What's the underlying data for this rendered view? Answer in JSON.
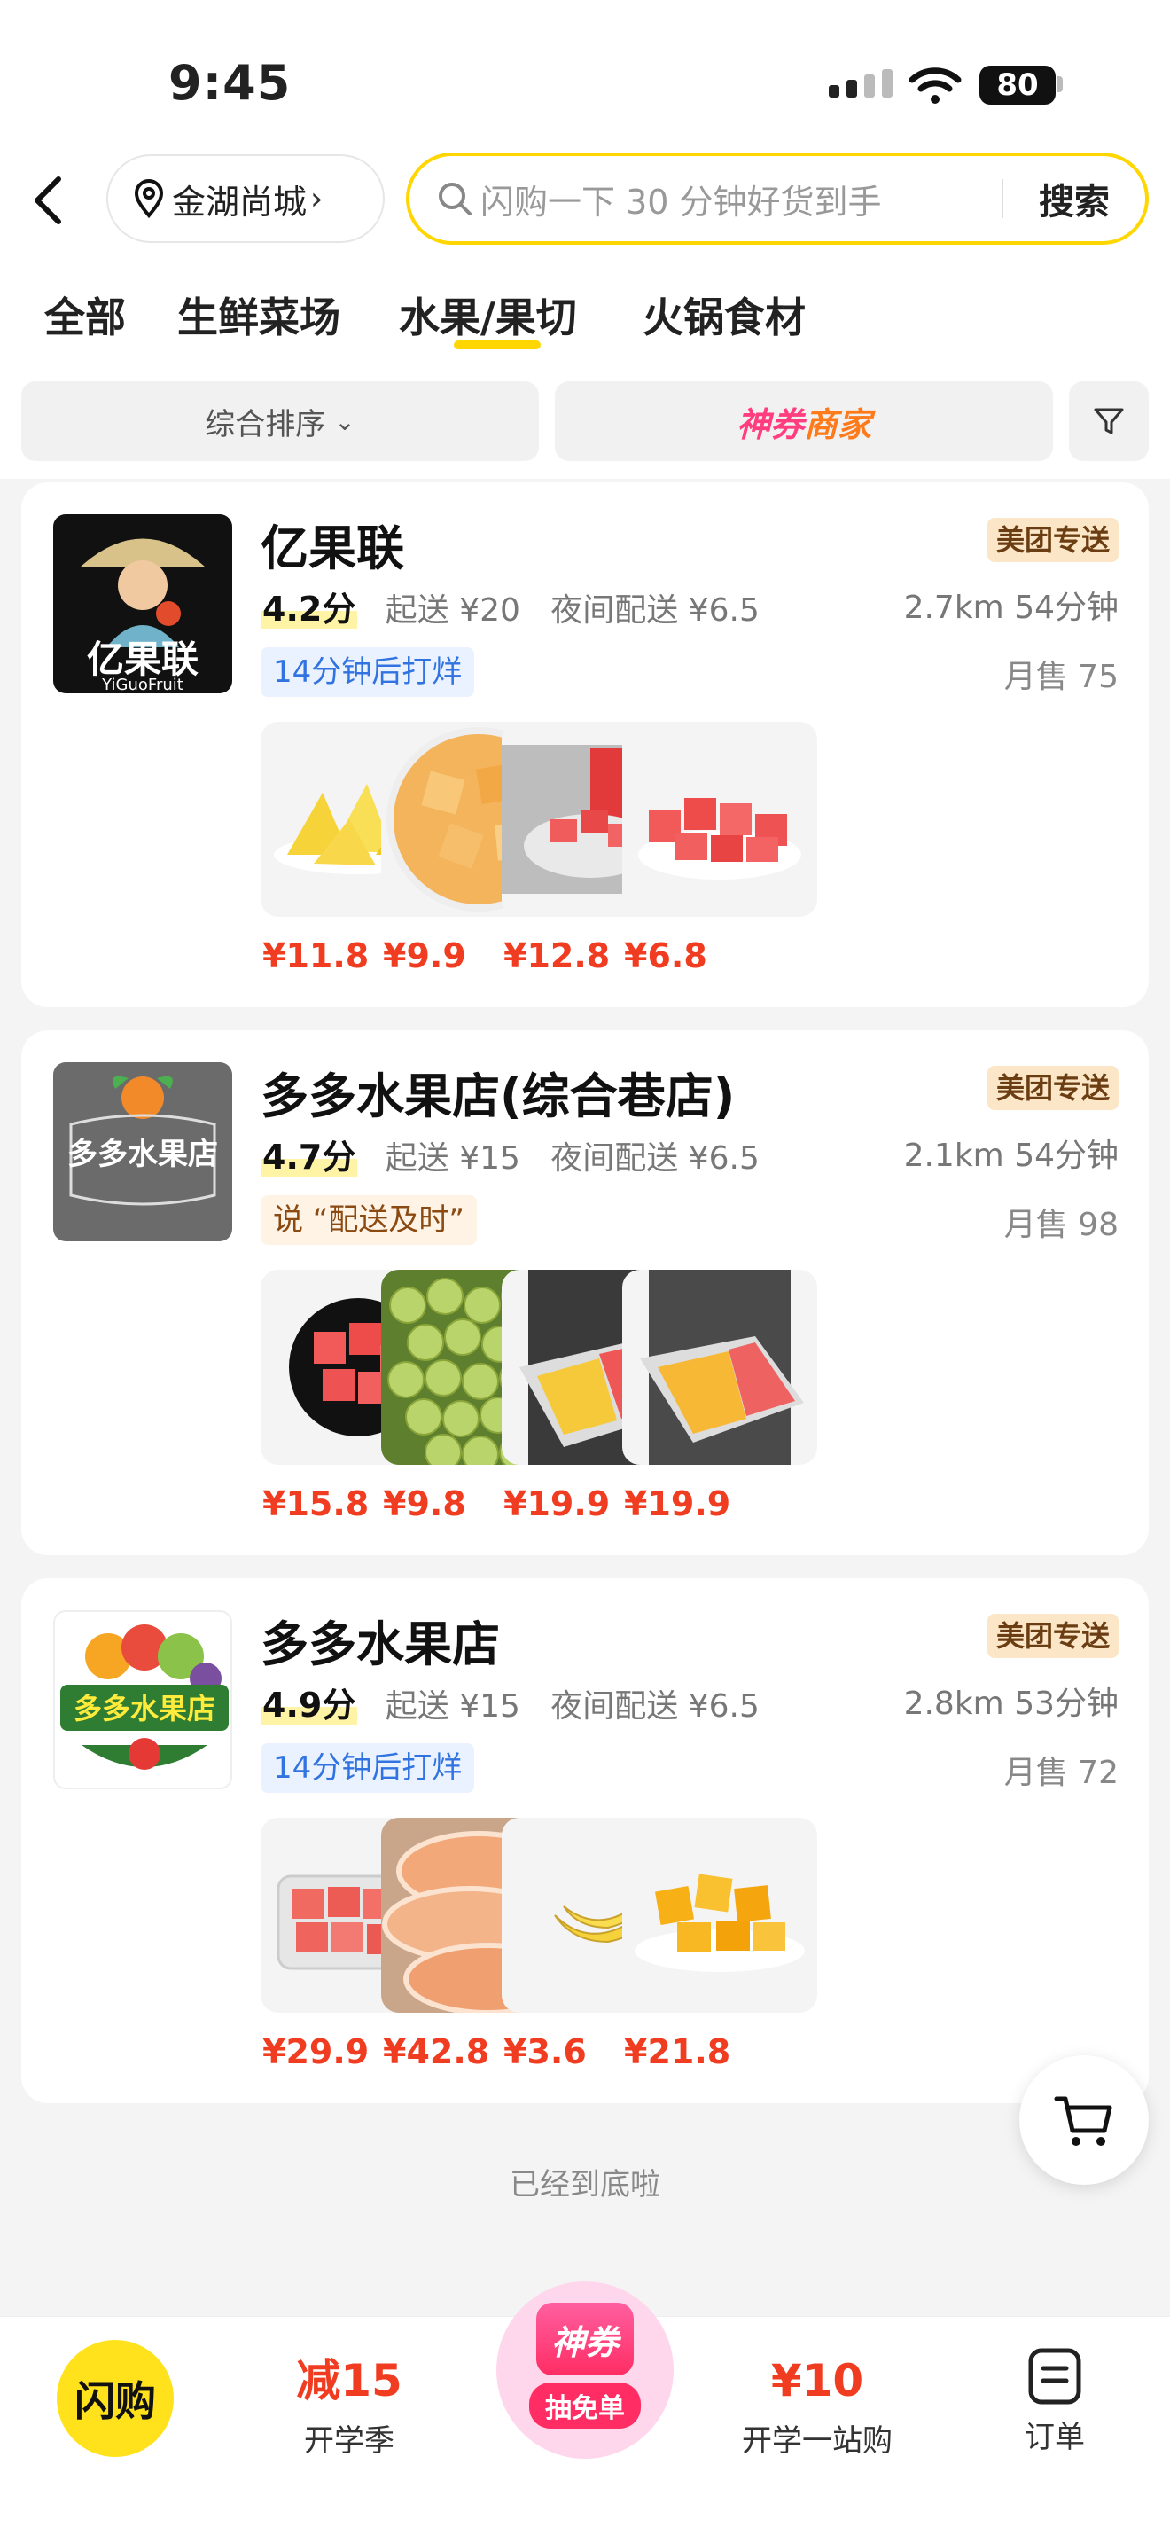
{
  "status_bar": {
    "time": "9:45",
    "battery": "80"
  },
  "header": {
    "location": "金湖尚城",
    "search_placeholder": "闪购一下 30 分钟好货到手",
    "search_button": "搜索"
  },
  "tabs": [
    "全部",
    "生鲜菜场",
    "水果/果切",
    "火锅食材"
  ],
  "active_tab": 2,
  "filters": {
    "sort": "综合排序",
    "coupon_part1": "神券",
    "coupon_part2": "商家"
  },
  "stores": [
    {
      "name": "亿果联",
      "badge": "美团专送",
      "rating": "4.2分",
      "min_order": "起送 ¥20",
      "night_fee": "夜间配送 ¥6.5",
      "distance": "2.7km  54分钟",
      "tag": "14分钟后打烊",
      "sales": "月售 75",
      "logo_text": "亿果联",
      "logo_sub": "YiGuoFruit",
      "products": [
        {
          "fruit": "pineapple",
          "price": "¥11.8"
        },
        {
          "fruit": "cantaloupe",
          "price": "¥9.9"
        },
        {
          "fruit": "watermelon-juice",
          "price": "¥12.8"
        },
        {
          "fruit": "watermelon-cubes",
          "price": "¥6.8"
        }
      ]
    },
    {
      "name": "多多水果店(综合巷店)",
      "badge": "美团专送",
      "rating": "4.7分",
      "min_order": "起送 ¥15",
      "night_fee": "夜间配送 ¥6.5",
      "distance": "2.1km  54分钟",
      "tag": "说 “配送及时”",
      "sales": "月售 98",
      "logo_text": "多多水果店",
      "products": [
        {
          "fruit": "watermelon-bowl",
          "price": "¥15.8"
        },
        {
          "fruit": "green-grapes",
          "price": "¥9.8"
        },
        {
          "fruit": "fruit-box",
          "price": "¥19.9"
        },
        {
          "fruit": "fruit-box-2",
          "price": "¥19.9"
        }
      ]
    },
    {
      "name": "多多水果店",
      "badge": "美团专送",
      "rating": "4.9分",
      "min_order": "起送 ¥15",
      "night_fee": "夜间配送 ¥6.5",
      "distance": "2.8km  53分钟",
      "tag": "14分钟后打烊",
      "sales": "月售 72",
      "logo_text": "多多水果店",
      "products": [
        {
          "fruit": "watermelon-box",
          "price": "¥29.9"
        },
        {
          "fruit": "pomelo",
          "price": "¥42.8"
        },
        {
          "fruit": "banana",
          "price": "¥3.6"
        },
        {
          "fruit": "mango",
          "price": "¥21.8"
        }
      ]
    }
  ],
  "end_text": "已经到底啦",
  "bottom_nav": {
    "flash": "闪购",
    "item1_big": "减15",
    "item1_small": "开学季",
    "center_top": "神券",
    "center_pill": "抽免单",
    "item3_big": "¥10",
    "item3_small": "开学一站购",
    "order": "订单"
  },
  "colors": {
    "accent_yellow": "#ffd600",
    "price_red": "#f03c20",
    "tag_blue": "#3173e0"
  }
}
